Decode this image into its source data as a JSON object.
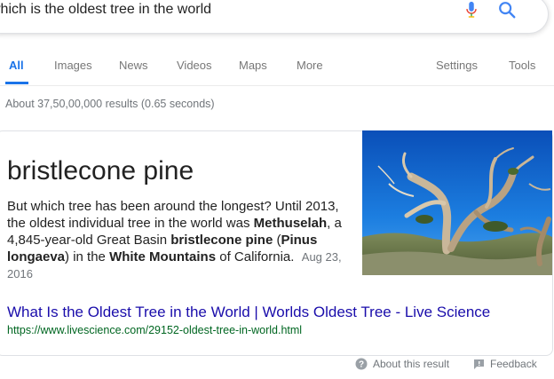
{
  "search": {
    "query": "which is the oldest tree in the world"
  },
  "tabs": [
    {
      "label": "All",
      "active": true
    },
    {
      "label": "Images"
    },
    {
      "label": "News"
    },
    {
      "label": "Videos"
    },
    {
      "label": "Maps"
    },
    {
      "label": "More"
    },
    {
      "label": "Settings"
    },
    {
      "label": "Tools"
    }
  ],
  "stats": "About 37,50,00,000 results (0.65 seconds)",
  "featured": {
    "title": "bristlecone pine",
    "snippet": {
      "p1": "But which tree has been around the longest? Until 2013, the oldest individual tree in the world was ",
      "b1": "Methuselah",
      "p2": ", a 4,845-year-old Great Basin ",
      "b2": "bristlecone pine",
      "p3": " (",
      "b3": "Pinus longaeva",
      "p4": ") in the ",
      "b4": "White Mountains",
      "p5": " of California."
    },
    "date": "Aug 23, 2016",
    "link_title": "What Is the Oldest Tree in the World | Worlds Oldest Tree - Live Science",
    "url": "https://www.livescience.com/29152-oldest-tree-in-world.html"
  },
  "footer": {
    "about": "About this result",
    "feedback": "Feedback"
  },
  "colors": {
    "accent": "#1a73e8",
    "link": "#1a0dab",
    "url": "#006621",
    "muted": "#70757a"
  },
  "icons": {
    "mic": "microphone-icon",
    "search": "search-icon",
    "about": "help-icon",
    "feedback": "feedback-icon"
  }
}
